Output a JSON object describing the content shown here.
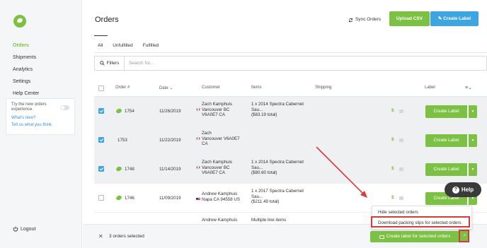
{
  "sidebar": {
    "nav": [
      "Orders",
      "Shipments",
      "Analytics",
      "Settings",
      "Help Center"
    ],
    "promo": {
      "text": "Try the new orders experience",
      "link1": "What's new?",
      "link2": "Tell us what you think"
    },
    "logout": "Logout"
  },
  "header": {
    "title": "Orders",
    "sync": "Sync Orders",
    "upload": "Upload CSV",
    "create": "Create Label"
  },
  "tabs": [
    "All",
    "Unfulfilled",
    "Fulfilled"
  ],
  "filters": {
    "label": "Filters",
    "placeholder": "Search for..."
  },
  "table": {
    "headers": {
      "order": "Order #",
      "date": "Date",
      "customer": "Customer",
      "items": "Items",
      "shipping": "Shipping",
      "label": "Label"
    },
    "rows": [
      {
        "order": "1754",
        "date": "11/26/2019",
        "name": "Zach Kamphuis",
        "addr1": "Vancouver BC",
        "addr2": "V6A0E7 CA",
        "item1": "1 x 2014 Spectra Cabernet",
        "item2": "Sau...",
        "total": "($83.19 total)",
        "label": "Create Label",
        "checked": true
      },
      {
        "order": "1753",
        "date": "11/22/2019",
        "name": "Zach",
        "addr1": "Vancouver V6A0E7",
        "addr2": "CA",
        "item1": "",
        "item2": "",
        "total": "",
        "label": "Create Label",
        "checked": true
      },
      {
        "order": "1748",
        "date": "11/14/2019",
        "name": "Zach Kamphuis",
        "addr1": "Vancouver BC",
        "addr2": "V6A0E7 CA",
        "item1": "1 x 2014 Spectra Cabernet",
        "item2": "Sau...",
        "total": "($80.60 total)",
        "label": "Create Label",
        "checked": true
      },
      {
        "order": "1746",
        "date": "11/09/2019",
        "name": "Andrew Kamphuis",
        "addr1": "Napa CA 94558 US",
        "addr2": "",
        "item1": "1 x 2017 Spectra Cabernet",
        "item2": "Sau...",
        "total": "($211.49 total)",
        "label": "Create Label",
        "checked": false
      },
      {
        "order": "",
        "date": "",
        "name": "Andrew Kamphuis",
        "addr1": "",
        "addr2": "",
        "item1": "Multiple line items",
        "item2": "",
        "total": "",
        "label": "",
        "checked": false
      }
    ]
  },
  "currency_symbol": "$",
  "help": "Help",
  "dropdown": {
    "item1": "Hide selected orders",
    "item2": "Download packing slips for selected orders"
  },
  "bottom": {
    "selected": "3 orders selected",
    "bulk": "Create label for selected orders"
  },
  "colors": {
    "accent_green": "#7cc143",
    "accent_blue": "#3ea5e0",
    "annotation_red": "#d83a3a"
  }
}
